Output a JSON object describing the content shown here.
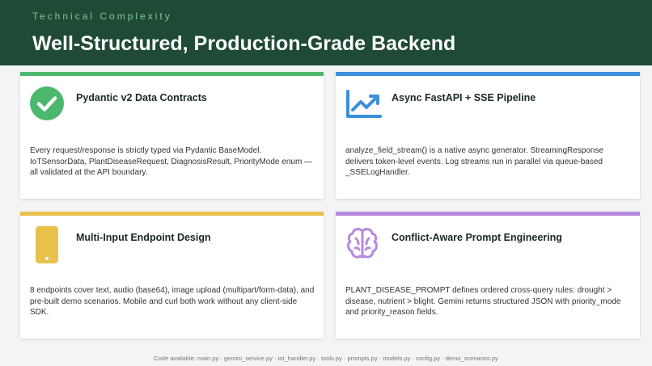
{
  "header": {
    "eyebrow": "Technical Complexity",
    "title": "Well-Structured, Production-Grade Backend"
  },
  "cards": [
    {
      "title": "Pydantic v2 Data Contracts",
      "description": "Every request/response is strictly typed via Pydantic BaseModel. IoTSensorData, PlantDiseaseRequest, DiagnosisResult, PriorityMode enum — all validated at the API boundary.",
      "accent": "#4cb86e",
      "icon": "check-circle-icon"
    },
    {
      "title": "Async FastAPI + SSE Pipeline",
      "description": "analyze_field_stream() is a native async generator. StreamingResponse delivers token-level events. Log streams run in parallel via queue-based _SSELogHandler.",
      "accent": "#3b8fdd",
      "icon": "trending-chart-icon"
    },
    {
      "title": "Multi-Input Endpoint Design",
      "description": "8 endpoints cover text, audio (base64), image upload (multipart/form-data), and pre-built demo scenarios. Mobile and curl both work without any client-side SDK.",
      "accent": "#e8c14a",
      "icon": "mobile-phone-icon"
    },
    {
      "title": "Conflict-Aware Prompt Engineering",
      "description": "PLANT_DISEASE_PROMPT defines ordered cross-query rules: drought > disease, nutrient > blight. Gemini returns structured JSON with priority_mode and priority_reason fields.",
      "accent": "#b58ae0",
      "icon": "brain-icon"
    }
  ],
  "footer": {
    "text": "Code available: main.py · gemini_service.py · iot_handler.py · tools.py · prompts.py · models.py · config.py · demo_scenarios.py"
  },
  "colors": {
    "header_bg": "#1f4a35",
    "eyebrow": "#7fc79a"
  }
}
